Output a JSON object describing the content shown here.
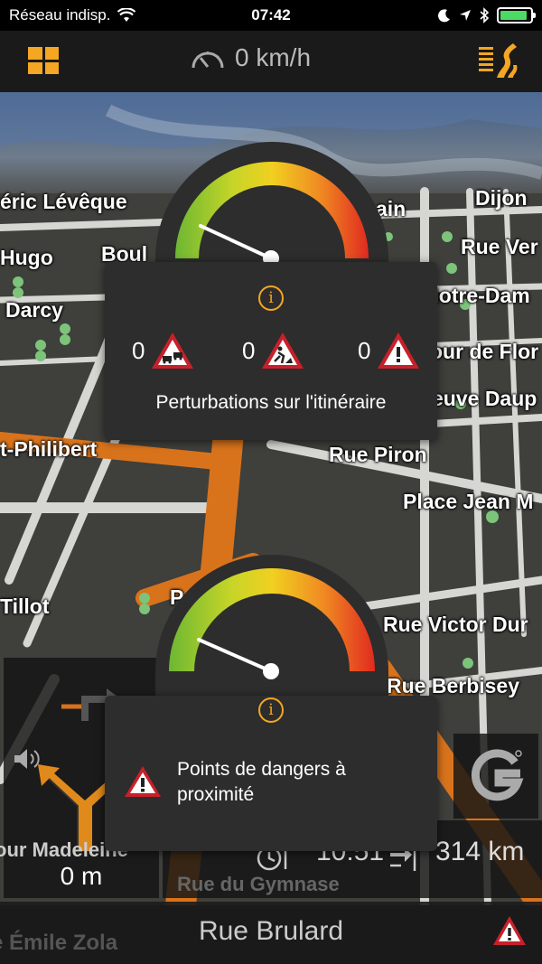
{
  "status": {
    "carrier": "Réseau indisp.",
    "time": "07:42",
    "battery_level": 0.9
  },
  "top_bar": {
    "speed": "0 km/h"
  },
  "map": {
    "streets": [
      "éric Lévêque",
      "Hugo",
      "Boul",
      "Darcy",
      "ain",
      "Dijon",
      "Rue Ver",
      "lace Notre-Dam",
      "our de Flor",
      "euve Daup",
      "t-Philibert",
      "Rue Piron",
      "Place Jean M",
      "Tillot",
      "P",
      "Rue Victor Dur",
      "Rue Berbisey"
    ]
  },
  "traffic_popup": {
    "congestion_count": "0",
    "roadworks_count": "0",
    "danger_count": "0",
    "title": "Perturbations sur l'itinéraire"
  },
  "danger_popup": {
    "title_line1": "Points de dangers à",
    "title_line2": "proximité"
  },
  "navigation": {
    "next_street": "our Madeleine",
    "distance": "0 m",
    "eta": "10:51",
    "remaining": "314 km",
    "gymnase_street": "Rue du Gymnase",
    "current_street": "Rue Brulard",
    "side_street": "e Émile Zola"
  },
  "colors": {
    "accent": "#f5a623",
    "road_orange": "#d8731c",
    "warning_red": "#c8202a"
  }
}
